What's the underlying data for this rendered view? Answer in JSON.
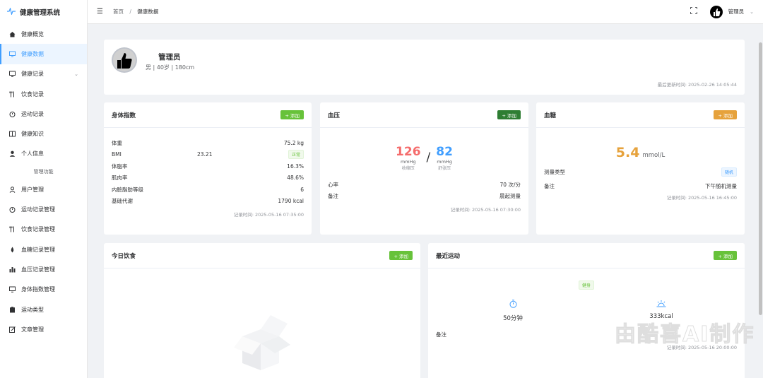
{
  "app": {
    "title": "健康管理系统"
  },
  "sidebar": {
    "items": [
      {
        "label": "健康概览",
        "icon": "home-icon"
      },
      {
        "label": "健康数据",
        "icon": "monitor-icon"
      },
      {
        "label": "健康记录",
        "icon": "record-icon"
      },
      {
        "label": "饮食记录",
        "icon": "fork-icon"
      },
      {
        "label": "运动记录",
        "icon": "timer-icon"
      },
      {
        "label": "健康知识",
        "icon": "book-icon"
      },
      {
        "label": "个人信息",
        "icon": "user-icon"
      }
    ],
    "group_label": "管理功能",
    "admin_items": [
      {
        "label": "用户管理",
        "icon": "user-outline-icon"
      },
      {
        "label": "运动记录管理",
        "icon": "timer-icon"
      },
      {
        "label": "饮食记录管理",
        "icon": "fork-icon"
      },
      {
        "label": "血糖记录管理",
        "icon": "drop-icon"
      },
      {
        "label": "血压记录管理",
        "icon": "bar-chart-icon"
      },
      {
        "label": "身体指数管理",
        "icon": "monitor-icon"
      },
      {
        "label": "运动类型",
        "icon": "clipboard-icon"
      },
      {
        "label": "文章管理",
        "icon": "edit-icon"
      }
    ]
  },
  "header": {
    "breadcrumb": [
      "首页",
      "健康数据"
    ],
    "breadcrumb_sep": "/",
    "user_name": "管理员"
  },
  "profile": {
    "name": "管理员",
    "info": "男 | 40岁 | 180cm",
    "updated": "最后更新时间: 2025-02-26 14:05:44"
  },
  "body_index": {
    "title": "身体指数",
    "add_label": "+ 添加",
    "rows": [
      {
        "label": "体重",
        "value": "75.2 kg"
      },
      {
        "label": "BMI",
        "value": "23.21",
        "tag": "正常"
      },
      {
        "label": "体脂率",
        "value": "16.3%"
      },
      {
        "label": "肌肉率",
        "value": "48.6%"
      },
      {
        "label": "内脏脂肪等级",
        "value": "6"
      },
      {
        "label": "基础代谢",
        "value": "1790 kcal"
      }
    ],
    "time": "记录时间: 2025-05-16 07:35:00"
  },
  "blood_pressure": {
    "title": "血压",
    "add_label": "+ 添加",
    "systolic": "126",
    "diastolic": "82",
    "unit": "mmHg",
    "systolic_label": "收缩压",
    "diastolic_label": "舒张压",
    "slash": "/",
    "heart_rate_label": "心率",
    "heart_rate": "70 次/分",
    "note_label": "备注",
    "note": "晨起测量",
    "time": "记录时间: 2025-05-16 07:30:00",
    "systolic_color": "#f56c6c",
    "diastolic_color": "#409eff"
  },
  "blood_sugar": {
    "title": "血糖",
    "add_label": "+ 添加",
    "value": "5.4",
    "unit": "mmol/L",
    "type_label": "测量类型",
    "type_value": "随机",
    "note_label": "备注",
    "note": "下午随机测量",
    "time": "记录时间: 2025-05-16 16:45:00",
    "value_color": "#e6a23c"
  },
  "diet": {
    "title": "今日饮食",
    "add_label": "+ 添加"
  },
  "exercise": {
    "title": "最近运动",
    "add_label": "+ 添加",
    "type_tag": "健身",
    "duration": "50分钟",
    "calories": "333kcal",
    "note_label": "备注",
    "time": "记录时间: 2025-05-16 20:00:00"
  },
  "watermark": "由酷喜AI制作"
}
